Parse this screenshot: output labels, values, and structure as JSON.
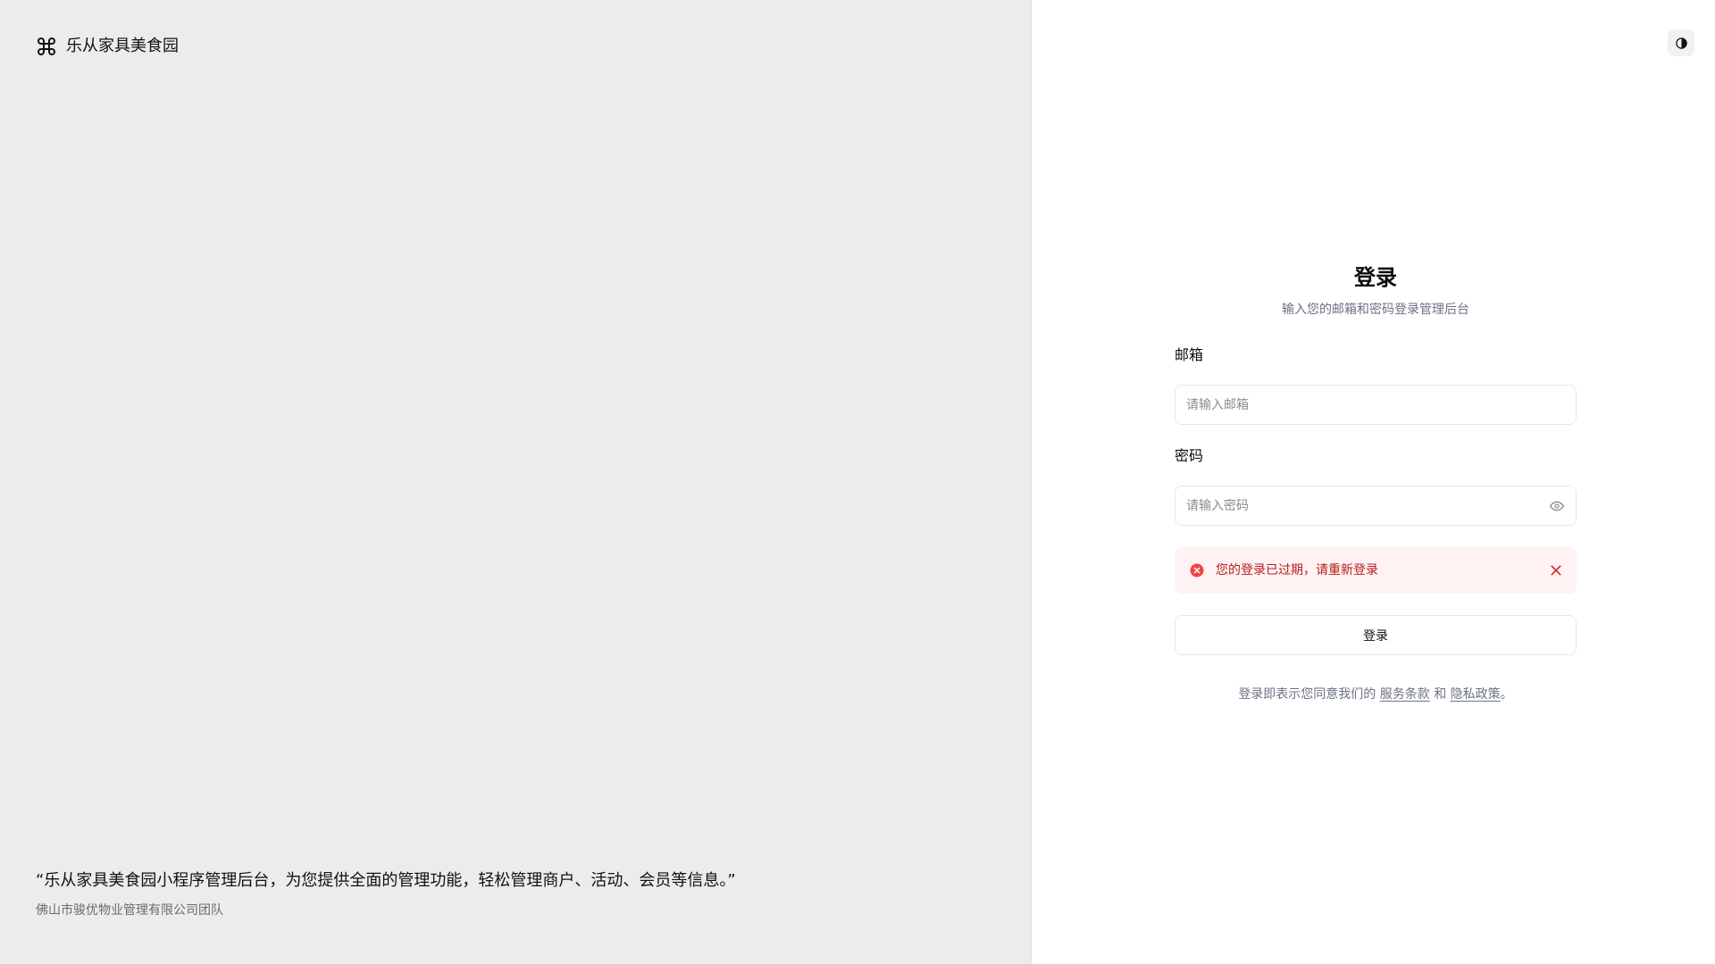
{
  "brand": {
    "name": "乐从家具美食园",
    "icon": "command-icon"
  },
  "quote": {
    "text": "“乐从家具美食园小程序管理后台，为您提供全面的管理功能，轻松管理商户、活动、会员等信息。”",
    "author": "佛山市骏优物业管理有限公司团队"
  },
  "theme_toggle": {
    "icon": "contrast-icon"
  },
  "login": {
    "title": "登录",
    "subtitle": "输入您的邮箱和密码登录管理后台",
    "email_label": "邮箱",
    "email_placeholder": "请输入邮箱",
    "email_value": "",
    "password_label": "密码",
    "password_placeholder": "请输入密码",
    "password_value": "",
    "error_message": "您的登录已过期，请重新登录",
    "submit_label": "登录",
    "terms": {
      "prefix": "登录即表示您同意我们的",
      "terms_link": "服务条款",
      "and": "和",
      "privacy_link": "隐私政策",
      "suffix": "。"
    }
  },
  "colors": {
    "left_bg": "#ececec",
    "alert_bg": "#fef2f2",
    "alert_text": "#b91c1c",
    "alert_icon": "#ef4444",
    "muted_text": "#6b7280"
  }
}
